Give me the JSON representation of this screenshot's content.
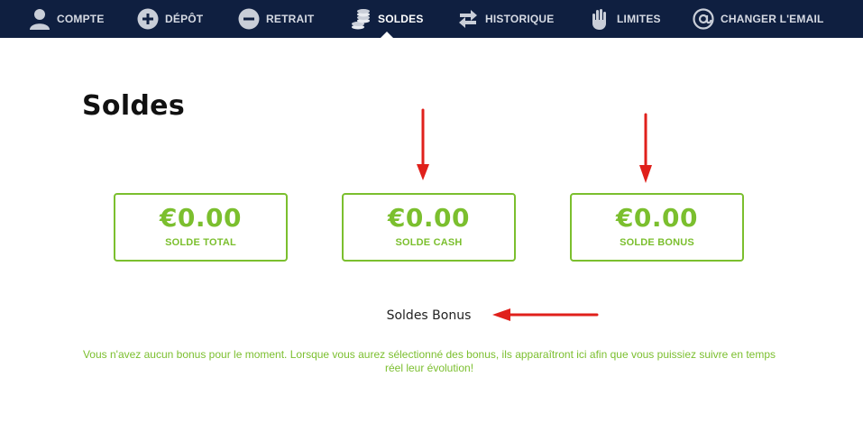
{
  "nav": {
    "items": [
      {
        "label": "COMPTE",
        "icon": "user-icon",
        "active": false
      },
      {
        "label": "DÉPÔT",
        "icon": "plus-circle-icon",
        "active": false
      },
      {
        "label": "RETRAIT",
        "icon": "minus-circle-icon",
        "active": false
      },
      {
        "label": "SOLDES",
        "icon": "coins-icon",
        "active": true
      },
      {
        "label": "HISTORIQUE",
        "icon": "swap-arrows-icon",
        "active": false
      },
      {
        "label": "LIMITES",
        "icon": "hand-icon",
        "active": false
      },
      {
        "label": "CHANGER L'EMAIL",
        "icon": "at-icon",
        "active": false
      }
    ]
  },
  "page": {
    "title": "Soldes"
  },
  "balances": [
    {
      "amount": "€0.00",
      "label": "SOLDE TOTAL"
    },
    {
      "amount": "€0.00",
      "label": "SOLDE CASH"
    },
    {
      "amount": "€0.00",
      "label": "SOLDE BONUS"
    }
  ],
  "bonus_section": {
    "title": "Soldes Bonus",
    "message": "Vous n'avez aucun bonus pour le moment. Lorsque vous aurez sélectionné des bonus, ils apparaîtront ici afin que vous puissiez suivre en temps réel leur évolution!"
  },
  "colors": {
    "nav_bg": "#0f1f40",
    "accent_green": "#7bbf2e",
    "annotation_red": "#e0201b"
  }
}
